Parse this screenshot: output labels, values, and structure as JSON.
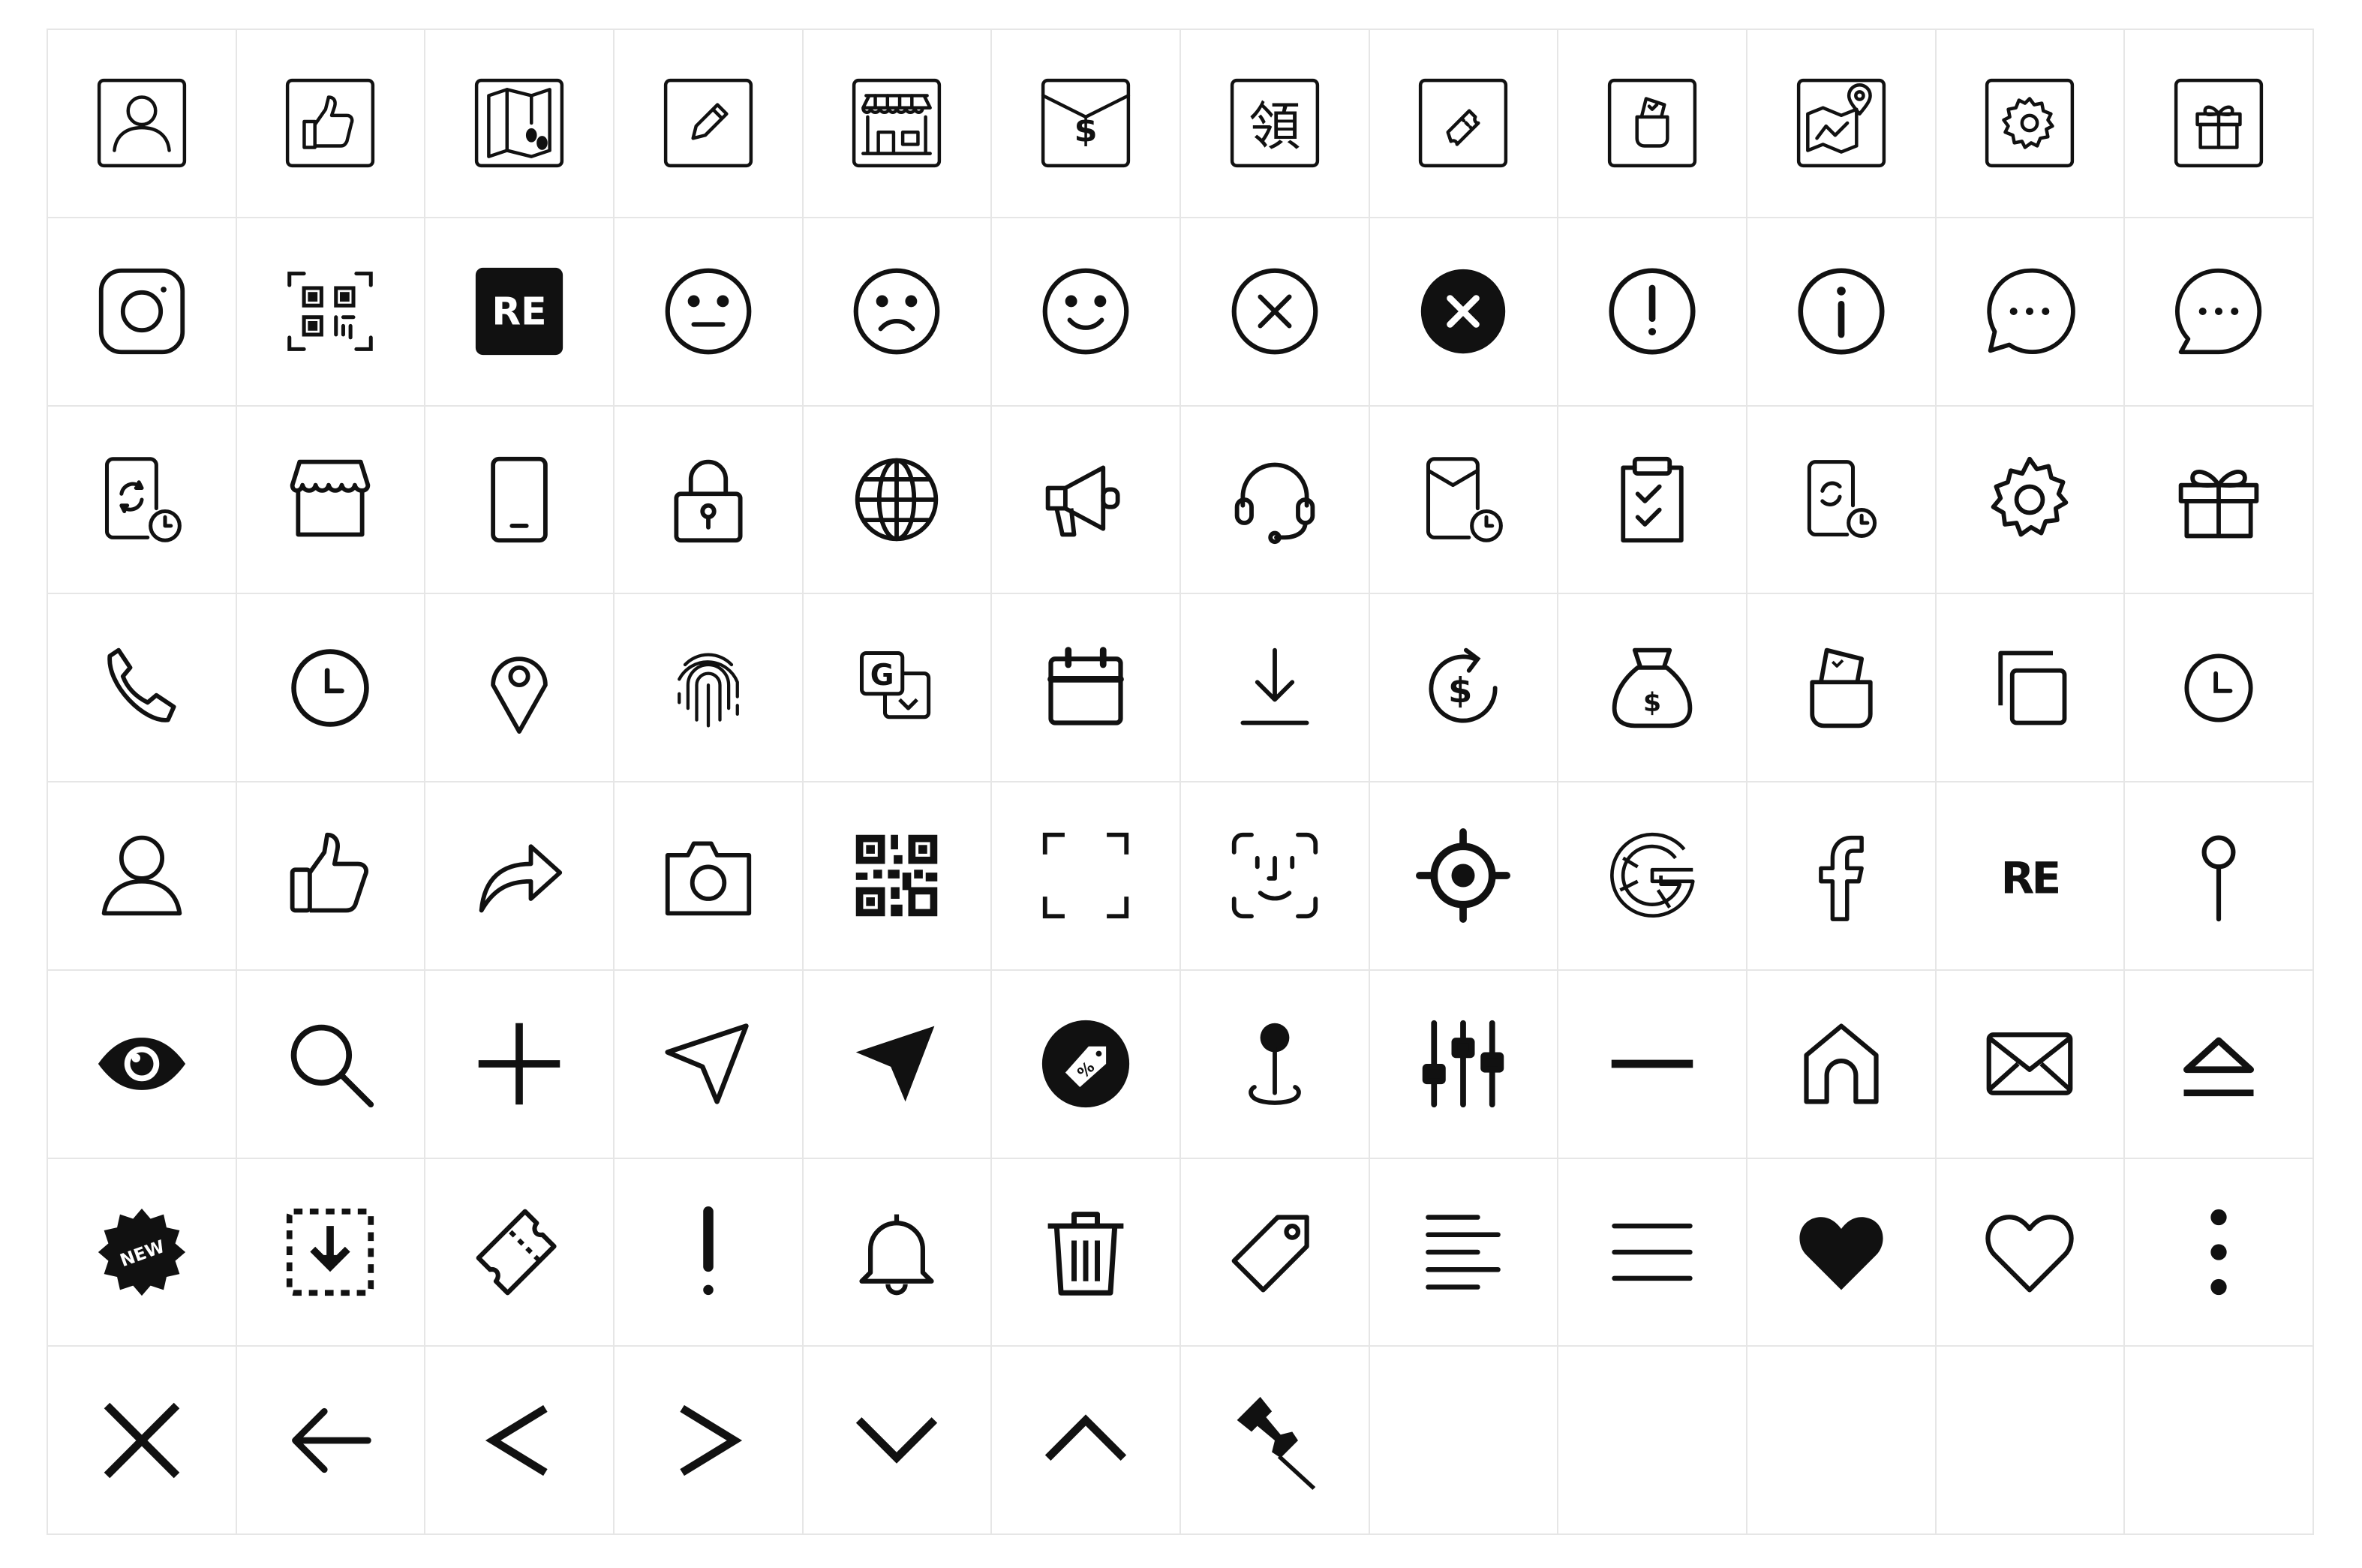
{
  "icons": [
    {
      "name": "boxed-user-icon"
    },
    {
      "name": "boxed-thumbs-up-icon"
    },
    {
      "name": "boxed-map-footprints-icon"
    },
    {
      "name": "boxed-pencil-icon"
    },
    {
      "name": "boxed-store-icon"
    },
    {
      "name": "boxed-envelope-dollar-icon"
    },
    {
      "name": "boxed-collect-character-icon",
      "text": "領"
    },
    {
      "name": "boxed-ticket-icon"
    },
    {
      "name": "boxed-pocket-money-icon"
    },
    {
      "name": "boxed-map-pin-icon"
    },
    {
      "name": "boxed-gear-icon"
    },
    {
      "name": "boxed-gift-icon"
    },
    {
      "name": "instagram-icon"
    },
    {
      "name": "qr-scan-icon"
    },
    {
      "name": "re-logo-boxed-icon",
      "text": "RE"
    },
    {
      "name": "neutral-face-icon"
    },
    {
      "name": "sad-face-icon"
    },
    {
      "name": "smile-face-icon"
    },
    {
      "name": "close-circle-icon"
    },
    {
      "name": "close-circle-filled-icon"
    },
    {
      "name": "alert-circle-icon"
    },
    {
      "name": "info-circle-icon"
    },
    {
      "name": "chat-bubble-dots-icon"
    },
    {
      "name": "chat-bubble-dots-alt-icon"
    },
    {
      "name": "device-sync-clock-icon"
    },
    {
      "name": "store-icon"
    },
    {
      "name": "mobile-phone-icon"
    },
    {
      "name": "lock-icon"
    },
    {
      "name": "globe-icon"
    },
    {
      "name": "megaphone-icon"
    },
    {
      "name": "headset-icon"
    },
    {
      "name": "envelope-clock-icon"
    },
    {
      "name": "clipboard-check-icon"
    },
    {
      "name": "device-sync-clock-small-icon"
    },
    {
      "name": "gear-icon"
    },
    {
      "name": "gift-icon"
    },
    {
      "name": "phone-icon"
    },
    {
      "name": "clock-icon"
    },
    {
      "name": "map-pin-icon"
    },
    {
      "name": "fingerprint-icon"
    },
    {
      "name": "translate-icon",
      "text": "G"
    },
    {
      "name": "calendar-icon"
    },
    {
      "name": "download-icon"
    },
    {
      "name": "dollar-refresh-icon"
    },
    {
      "name": "money-bag-icon"
    },
    {
      "name": "pocket-money-icon"
    },
    {
      "name": "copy-icon"
    },
    {
      "name": "clock-small-icon"
    },
    {
      "name": "user-icon"
    },
    {
      "name": "thumbs-up-icon"
    },
    {
      "name": "share-arrow-icon"
    },
    {
      "name": "camera-icon"
    },
    {
      "name": "qr-code-icon"
    },
    {
      "name": "scan-frame-icon"
    },
    {
      "name": "face-id-icon"
    },
    {
      "name": "target-location-icon"
    },
    {
      "name": "google-icon"
    },
    {
      "name": "facebook-icon"
    },
    {
      "name": "re-logo-icon",
      "text": "RE"
    },
    {
      "name": "pin-icon"
    },
    {
      "name": "eye-icon"
    },
    {
      "name": "search-icon"
    },
    {
      "name": "plus-icon"
    },
    {
      "name": "navigation-arrow-icon"
    },
    {
      "name": "navigation-arrow-filled-icon"
    },
    {
      "name": "discount-tag-badge-icon",
      "text": "%"
    },
    {
      "name": "joystick-location-icon"
    },
    {
      "name": "sliders-icon"
    },
    {
      "name": "minus-icon"
    },
    {
      "name": "home-icon"
    },
    {
      "name": "mail-icon"
    },
    {
      "name": "eject-icon"
    },
    {
      "name": "new-badge-icon",
      "text": "NEW"
    },
    {
      "name": "download-box-icon"
    },
    {
      "name": "ticket-icon"
    },
    {
      "name": "exclamation-icon"
    },
    {
      "name": "bell-icon"
    },
    {
      "name": "trash-icon"
    },
    {
      "name": "price-tag-icon"
    },
    {
      "name": "align-left-icon"
    },
    {
      "name": "menu-icon"
    },
    {
      "name": "heart-filled-icon"
    },
    {
      "name": "heart-icon"
    },
    {
      "name": "more-vertical-icon"
    },
    {
      "name": "close-icon"
    },
    {
      "name": "arrow-left-icon"
    },
    {
      "name": "chevron-left-icon"
    },
    {
      "name": "chevron-right-icon"
    },
    {
      "name": "chevron-down-icon"
    },
    {
      "name": "chevron-up-icon"
    },
    {
      "name": "push-pin-icon"
    }
  ]
}
